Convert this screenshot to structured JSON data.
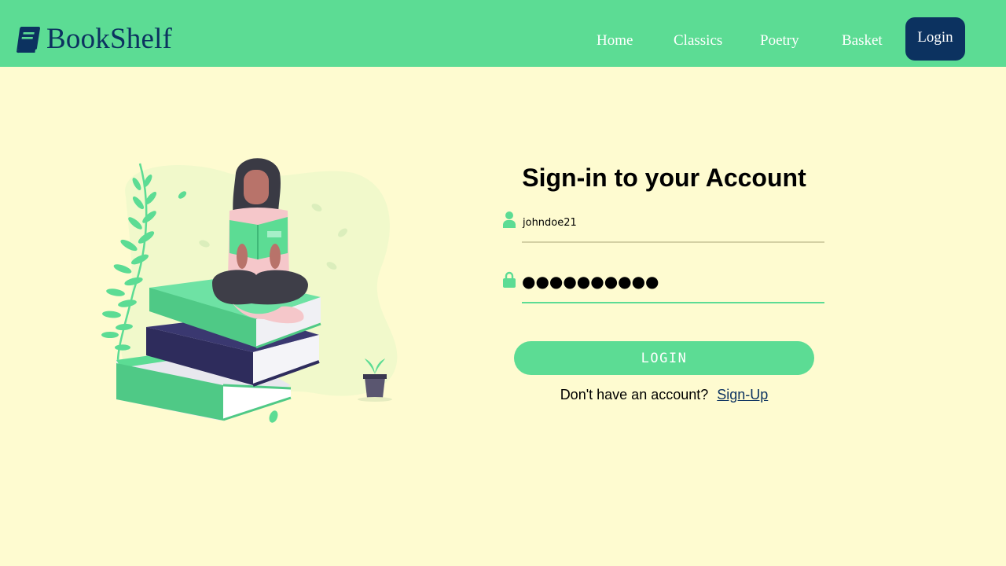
{
  "brand": {
    "name": "BookShelf",
    "icon": "book-icon"
  },
  "nav": {
    "items": [
      {
        "label": "Home"
      },
      {
        "label": "Classics"
      },
      {
        "label": "Poetry"
      },
      {
        "label": "Basket"
      }
    ],
    "login_label": "Login"
  },
  "form": {
    "title": "Sign-in to your Account",
    "username": {
      "value": "johndoe21",
      "icon": "user-icon"
    },
    "password": {
      "value": "●●●●●●●●●●",
      "icon": "lock-icon"
    },
    "submit_label": "LOGIN",
    "signup_prompt": "Don't have an account?",
    "signup_link": "Sign-Up"
  },
  "colors": {
    "navbar": "#5cdc94",
    "background": "#fefbd0",
    "brand": "#0c3260",
    "accent": "#5cdc94"
  }
}
